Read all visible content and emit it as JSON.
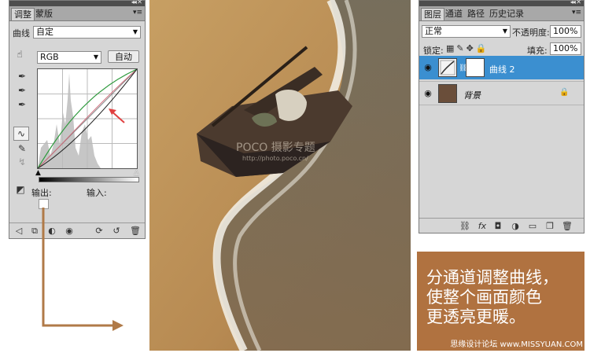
{
  "adjustments_panel": {
    "tabs": [
      "调整",
      "蒙版"
    ],
    "title_label": "曲线",
    "preset_value": "自定",
    "channel_value": "RGB",
    "auto_button": "自动",
    "output_label": "输出:",
    "input_label": "输入:"
  },
  "photo": {
    "watermark_main": "POCO 摄影专题",
    "watermark_url": "http://photo.poco.cn/"
  },
  "layers_panel": {
    "tabs": [
      "图层",
      "通道",
      "路径",
      "历史记录"
    ],
    "blend_mode": "正常",
    "opacity_label": "不透明度:",
    "opacity_value": "100%",
    "lock_label": "锁定:",
    "fill_label": "填充:",
    "fill_value": "100%",
    "layers": [
      {
        "name": "曲线 2",
        "selected": true
      },
      {
        "name": "背景",
        "selected": false
      }
    ]
  },
  "annotation": {
    "lines": [
      "分通道调整曲线，",
      "使整个画面颜色",
      "更透亮更暖。"
    ],
    "colors": {
      "box": "#b07240",
      "arrow": "#b07a48"
    }
  },
  "footer_watermark": "思缘设计论坛 www.MISSYUAN.COM"
}
